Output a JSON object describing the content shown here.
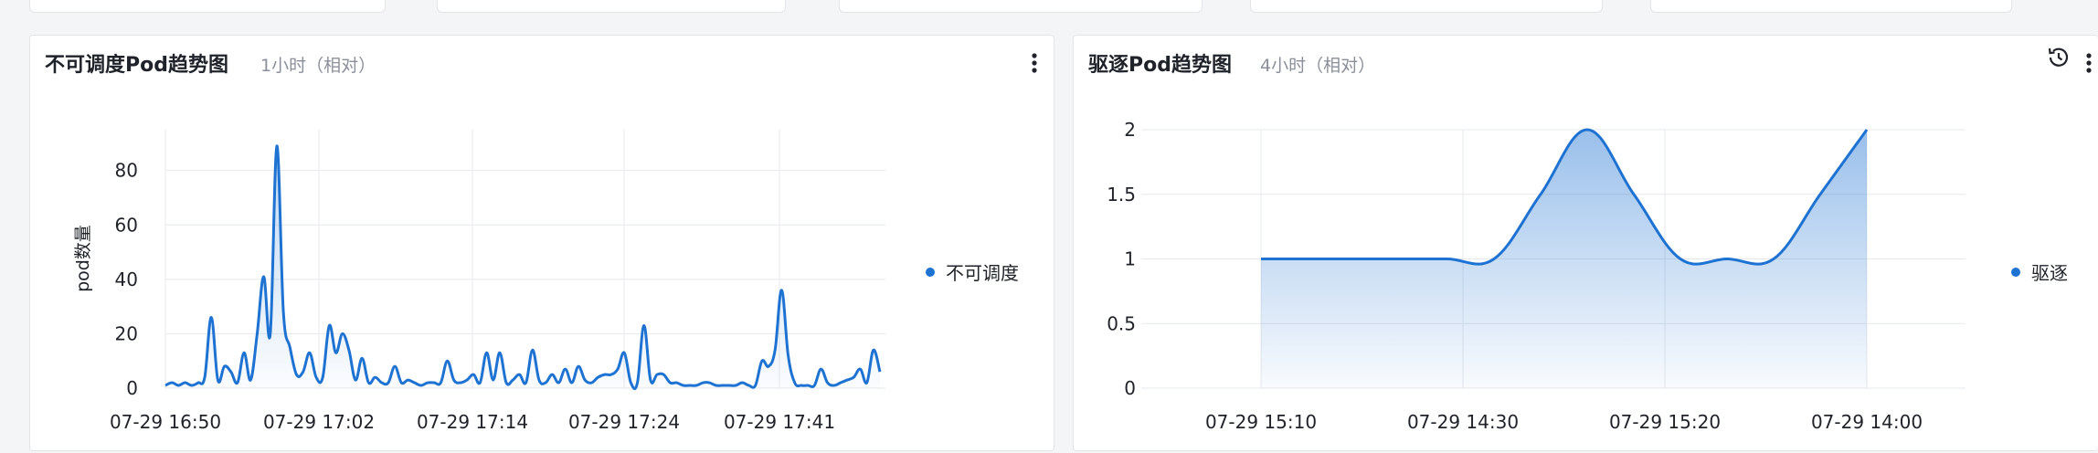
{
  "cards": [
    {
      "title": "不可调度Pod趋势图",
      "subtitle": "1小时（相对）",
      "legend": "不可调度"
    },
    {
      "title": "驱逐Pod趋势图",
      "subtitle": "4小时（相对）",
      "legend": "驱逐"
    }
  ],
  "colors": {
    "series": "#1e72d2",
    "grid": "#e6e8eb",
    "text": "#1f2329"
  },
  "icons": {
    "menu": "more-vertical-icon",
    "history": "history-icon"
  },
  "chart_data": [
    {
      "type": "line",
      "title": "不可调度Pod趋势图",
      "ylabel": "pod数量",
      "ylim": [
        0,
        95
      ],
      "yticks": [
        0,
        20,
        40,
        60,
        80
      ],
      "x_ticks": [
        "07-29 16:50",
        "07-29 17:02",
        "07-29 17:14",
        "07-29 17:24",
        "07-29 17:41"
      ],
      "series": [
        {
          "name": "不可调度",
          "values": [
            1,
            2,
            1,
            2,
            1,
            2,
            4,
            26,
            3,
            8,
            6,
            2,
            13,
            3,
            20,
            41,
            20,
            89,
            28,
            15,
            5,
            6,
            13,
            4,
            4,
            23,
            13,
            20,
            14,
            3,
            11,
            2,
            4,
            2,
            2,
            8,
            2,
            3,
            2,
            1,
            2,
            2,
            2,
            10,
            3,
            2,
            3,
            5,
            2,
            13,
            3,
            13,
            2,
            3,
            5,
            2,
            14,
            3,
            2,
            5,
            2,
            7,
            2,
            8,
            3,
            2,
            4,
            5,
            5,
            7,
            13,
            2,
            2,
            23,
            3,
            5,
            5,
            2,
            2,
            1,
            1,
            1,
            2,
            2,
            1,
            1,
            1,
            1,
            2,
            1,
            1,
            10,
            8,
            14,
            36,
            12,
            2,
            1,
            1,
            1,
            7,
            2,
            1,
            2,
            3,
            4,
            7,
            2,
            14,
            6
          ]
        }
      ]
    },
    {
      "type": "area",
      "title": "驱逐Pod趋势图",
      "ylim": [
        0,
        2
      ],
      "yticks": [
        0,
        0.5,
        1,
        1.5,
        2
      ],
      "x": [
        "07-29 15:10",
        "07-29 14:30",
        "07-29 15:20",
        "07-29 14:00"
      ],
      "series": [
        {
          "name": "驱逐",
          "values": [
            1,
            1,
            1,
            1,
            1,
            1,
            1.5,
            2,
            1.5,
            1,
            1,
            1,
            1.5,
            2
          ]
        }
      ]
    }
  ]
}
